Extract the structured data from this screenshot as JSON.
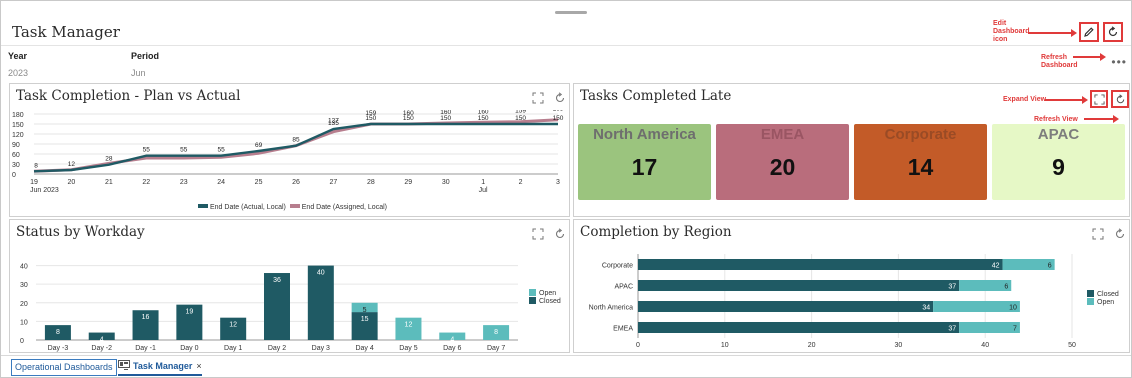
{
  "app": {
    "title": "Task Manager"
  },
  "header": {
    "annotations": {
      "edit": "Edit Dashboard icon",
      "refresh": "Refresh Dashboard"
    }
  },
  "pov": {
    "year_label": "Year",
    "year_value": "2023",
    "period_label": "Period",
    "period_value": "Jun"
  },
  "panels": {
    "plan_vs_actual": {
      "title": "Task Completion - Plan vs Actual"
    },
    "late": {
      "title": "Tasks Completed Late",
      "annotations": {
        "expand": "Expand View",
        "refresh": "Refresh View"
      },
      "tiles": [
        {
          "name": "North America",
          "value": "17"
        },
        {
          "name": "EMEA",
          "value": "20"
        },
        {
          "name": "Corporate",
          "value": "14"
        },
        {
          "name": "APAC",
          "value": "9"
        }
      ]
    },
    "workday": {
      "title": "Status by Workday"
    },
    "region": {
      "title": "Completion by Region"
    }
  },
  "tabs": [
    {
      "label": "Operational Dashboards"
    },
    {
      "label": "Task Manager",
      "close": "×"
    }
  ],
  "colors": {
    "dark_teal": "#1f5a64",
    "light_teal": "#5cbcbc",
    "mauve": "#b77e8e",
    "tile_green": "#9bc47e",
    "tile_mauve": "#b96d7c",
    "tile_orange": "#c35b28",
    "tile_lightgreen": "#e6f8c6",
    "annotation_red": "#e03a3a"
  },
  "icons": [
    "pencil-icon",
    "refresh-icon",
    "expand-icon",
    "more-icon",
    "dashboard-tab-icon",
    "close-icon"
  ],
  "chart_data": [
    {
      "type": "line",
      "title": "Task Completion - Plan vs Actual",
      "x": [
        "19",
        "20",
        "21",
        "22",
        "23",
        "24",
        "25",
        "26",
        "27",
        "28",
        "29",
        "30",
        "1",
        "2",
        "3"
      ],
      "x_sublabels": {
        "0": "Jun 2023",
        "12": "Jul"
      },
      "yticks": [
        "0",
        "30",
        "60",
        "90",
        "120",
        "150",
        "180"
      ],
      "ylim": [
        0,
        180
      ],
      "series": [
        {
          "name": "End Date (Actual, Local)",
          "values": [
            8,
            12,
            28,
            55,
            55,
            55,
            69,
            85,
            135,
            150,
            150,
            150,
            150,
            150,
            150
          ],
          "labels": [
            "8",
            "12",
            "28",
            "55",
            "55",
            "55",
            "69",
            "85",
            "135",
            "150",
            "150",
            "150",
            "150",
            "150",
            "150"
          ]
        },
        {
          "name": "End Date (Assigned, Local)",
          "values": [
            8,
            13,
            32,
            48,
            48,
            50,
            62,
            85,
            127,
            150,
            150,
            153,
            155,
            157,
            163
          ],
          "labels": [
            "",
            "",
            "",
            "",
            "",
            "",
            "",
            "",
            "127",
            "159",
            "160",
            "160",
            "160",
            "159",
            "163"
          ]
        }
      ],
      "legend_position": "bottom"
    },
    {
      "type": "bar",
      "title": "Status by Workday",
      "stacked": true,
      "categories": [
        "Day -3",
        "Day -2",
        "Day -1",
        "Day 0",
        "Day 1",
        "Day 2",
        "Day 3",
        "Day 4",
        "Day 5",
        "Day 6",
        "Day 7"
      ],
      "yticks": [
        "0",
        "10",
        "20",
        "30",
        "40"
      ],
      "ylim": [
        0,
        43
      ],
      "series": [
        {
          "name": "Closed",
          "values": [
            8,
            4,
            16,
            19,
            12,
            36,
            40,
            15,
            0,
            0,
            0
          ]
        },
        {
          "name": "Open",
          "values": [
            0,
            0,
            0,
            0,
            0,
            0,
            0,
            5,
            12,
            4,
            8
          ]
        }
      ],
      "legend_order": [
        "Open",
        "Closed"
      ],
      "legend_position": "right"
    },
    {
      "type": "bar",
      "orientation": "horizontal",
      "title": "Completion by Region",
      "stacked": true,
      "categories": [
        "Corporate",
        "APAC",
        "North America",
        "EMEA"
      ],
      "xticks": [
        "0",
        "10",
        "20",
        "30",
        "40",
        "50"
      ],
      "xlim": [
        0,
        50
      ],
      "series": [
        {
          "name": "Closed",
          "values": [
            42,
            37,
            34,
            37
          ]
        },
        {
          "name": "Open",
          "values": [
            6,
            6,
            10,
            7
          ]
        }
      ],
      "legend_position": "right"
    }
  ]
}
